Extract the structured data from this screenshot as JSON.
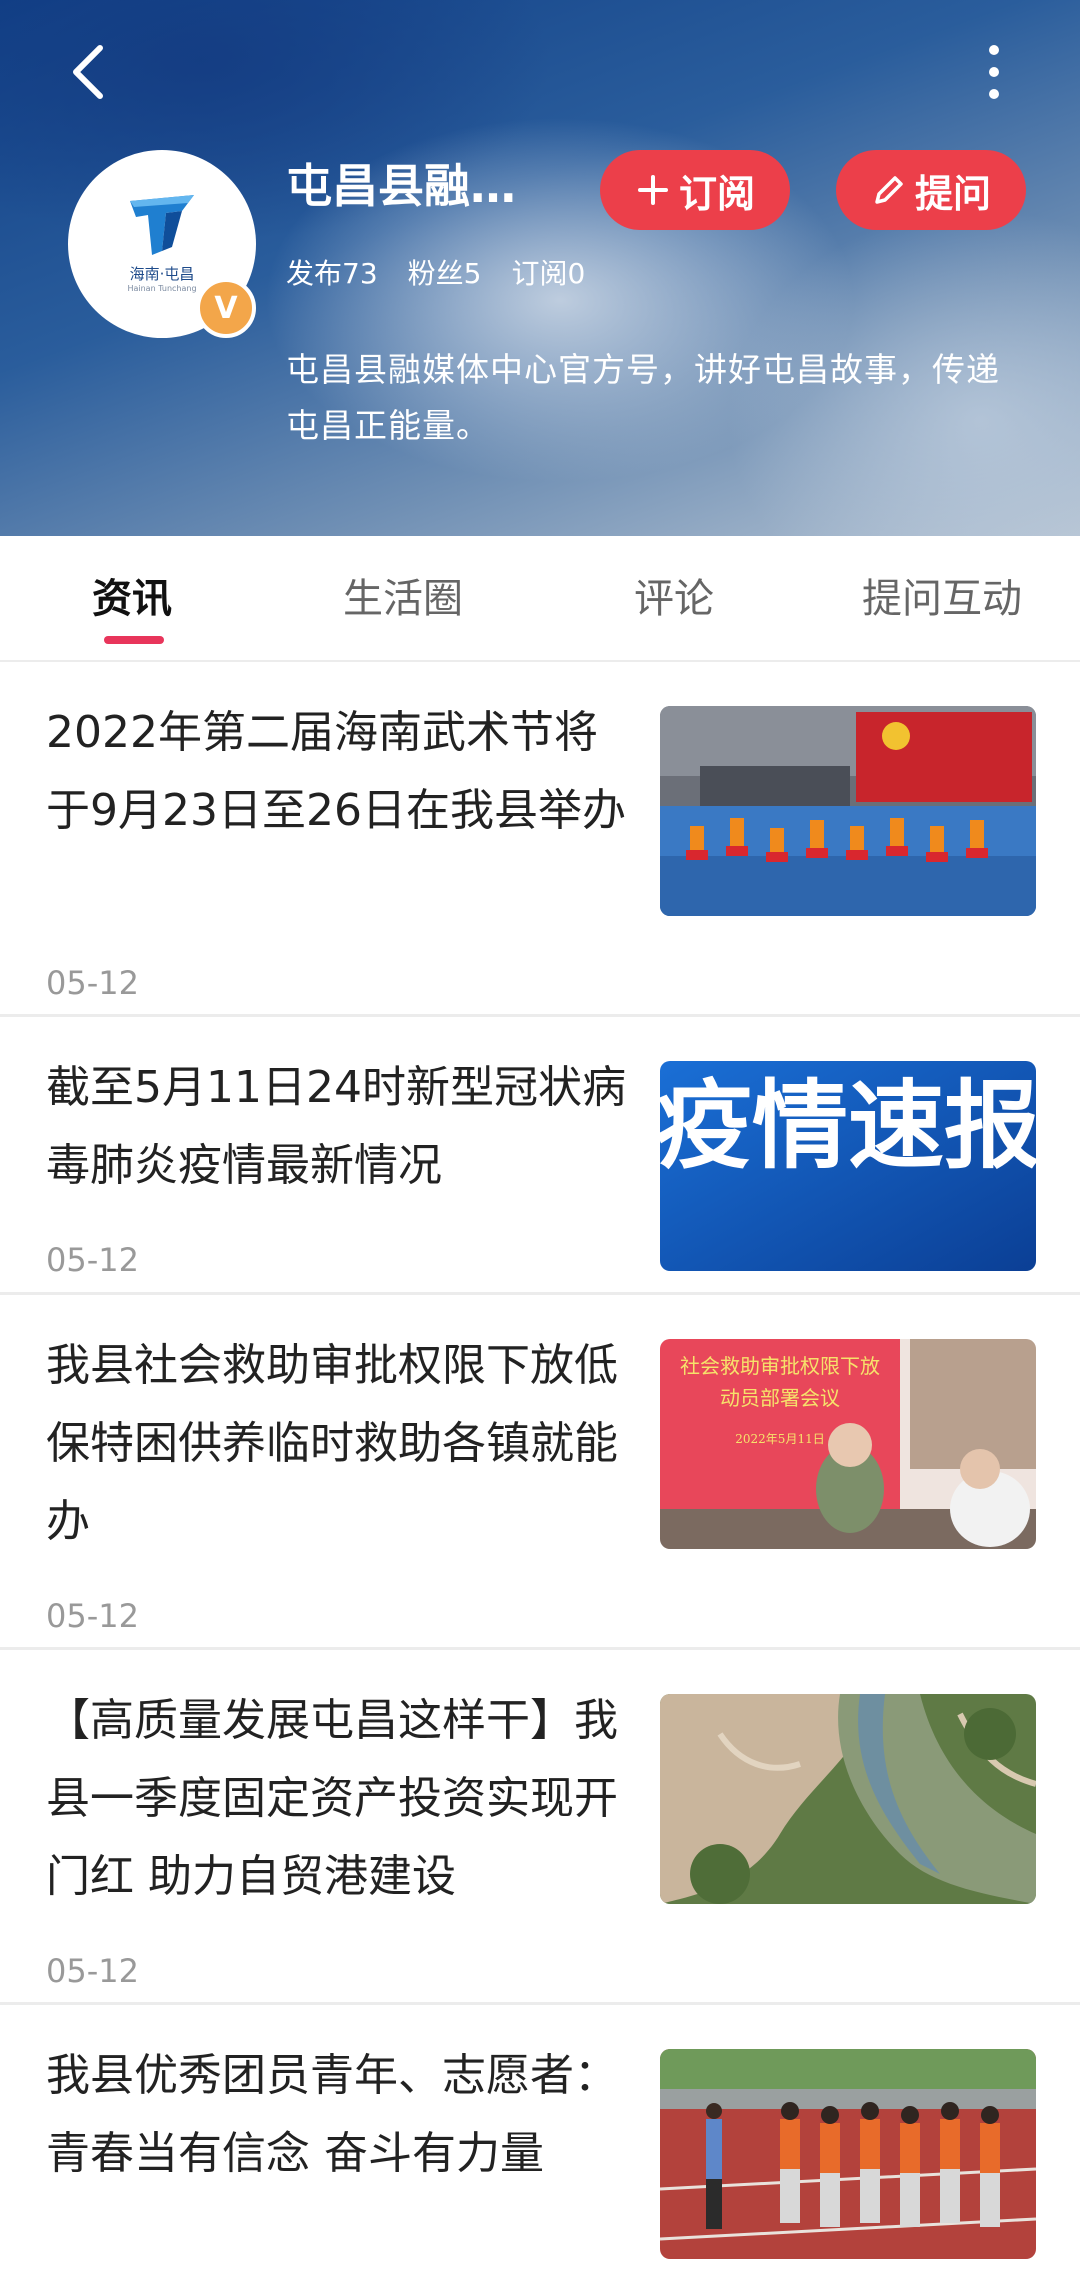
{
  "header": {
    "account_name": "屯昌县融…",
    "subscribe_label": "订阅",
    "ask_label": "提问",
    "verified_badge": "V",
    "logo_text": "海南·屯昌",
    "logo_subtext": "Hainan Tunchang",
    "stats": {
      "posts": "发布73",
      "fans": "粉丝5",
      "subscriptions": "订阅0"
    },
    "intro": "屯昌县融媒体中心官方号，讲好屯昌故事，传递屯昌正能量。",
    "accent_color": "#ec3f4a"
  },
  "tabs": [
    {
      "label": "资讯",
      "active": true
    },
    {
      "label": "生活圈",
      "active": false
    },
    {
      "label": "评论",
      "active": false
    },
    {
      "label": "提问互动",
      "active": false
    }
  ],
  "news": [
    {
      "title": "2022年第二届海南武术节将于9月23日至26日在我县举办",
      "date": "05-12",
      "image": "martial-arts-performance"
    },
    {
      "title": "截至5月11日24时新型冠状病毒肺炎疫情最新情况",
      "date": "05-12",
      "image": "epidemic-bulletin",
      "image_text": "疫情速报"
    },
    {
      "title": "我县社会救助审批权限下放低保特困供养临时救助各镇就能办",
      "date": "05-12",
      "image": "meeting-photo",
      "image_text_1": "社会救助审批权限下放",
      "image_text_2": "动员部署会议",
      "image_text_3": "2022年5月11日"
    },
    {
      "title": "【高质量发展屯昌这样干】我县一季度固定资产投资实现开门红 助力自贸港建设",
      "date": "05-12",
      "image": "aerial-construction"
    },
    {
      "title": "我县优秀团员青年、志愿者：青春当有信念 奋斗有力量",
      "date": "",
      "image": "students-on-track"
    }
  ]
}
